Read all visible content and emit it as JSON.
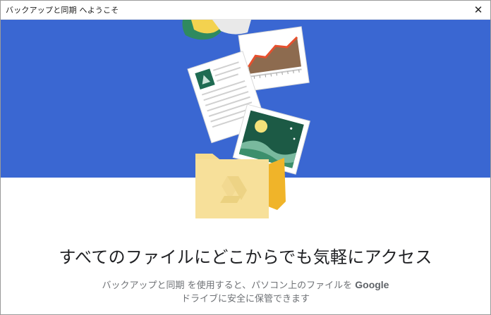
{
  "window": {
    "title": "バックアップと同期 へようこそ",
    "close_glyph": "✕"
  },
  "hero": {
    "background": "#3a67d2"
  },
  "content": {
    "headline": "すべてのファイルにどこからでも気軽にアクセス",
    "sub_line1_prefix": "バックアップと同期 を使用すると、パソコン上のファイルを ",
    "sub_line1_brand": "Google",
    "sub_line2": "ドライブに安全に保管できます"
  }
}
